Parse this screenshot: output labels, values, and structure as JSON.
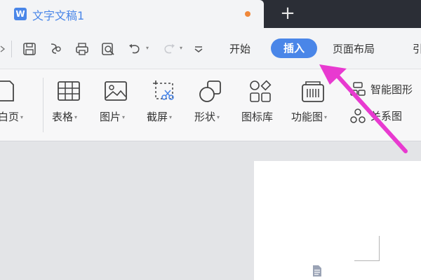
{
  "titlebar": {
    "doc_title": "文字文稿1",
    "doc_icon_letter": "W",
    "new_tab_symbol": "+"
  },
  "quick_access": {
    "icons": [
      "menu-caret-icon",
      "save-icon",
      "export-icon",
      "print-icon",
      "print-preview-icon",
      "undo-icon",
      "redo-icon",
      "customize-icon"
    ]
  },
  "menu": {
    "tabs": [
      {
        "label": "开始"
      },
      {
        "label": "插入",
        "active": true
      },
      {
        "label": "页面布局"
      },
      {
        "label": "引"
      }
    ]
  },
  "ribbon": {
    "items": [
      {
        "label": "白页",
        "has_caret": true
      },
      {
        "label": "表格",
        "has_caret": true
      },
      {
        "label": "图片",
        "has_caret": true
      },
      {
        "label": "截屏",
        "has_caret": true
      },
      {
        "label": "形状",
        "has_caret": true
      },
      {
        "label": "图标库",
        "has_caret": false
      },
      {
        "label": "功能图",
        "has_caret": true
      },
      {
        "label": "智能图形"
      },
      {
        "label": "关系图"
      }
    ],
    "caret_symbol": "▾"
  },
  "colors": {
    "accent": "#4a86e8",
    "arrow": "#e83ad0",
    "titlebar_bg": "#2b2e36",
    "unsaved_dot": "#f0883a"
  }
}
